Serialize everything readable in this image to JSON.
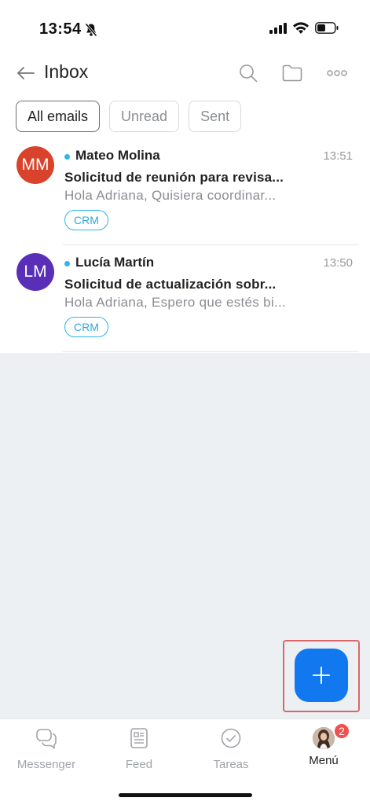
{
  "status_bar": {
    "time": "13:54"
  },
  "header": {
    "title": "Inbox"
  },
  "filters": [
    {
      "label": "All emails",
      "active": true
    },
    {
      "label": "Unread",
      "active": false
    },
    {
      "label": "Sent",
      "active": false
    }
  ],
  "emails": [
    {
      "initials": "MM",
      "avatar_color": "#d9432b",
      "sender": "Mateo Molina",
      "time": "13:51",
      "subject": "Solicitud de reunión para revisa...",
      "preview": "Hola Adriana, Quisiera coordinar...",
      "tag": "CRM"
    },
    {
      "initials": "LM",
      "avatar_color": "#5a2fb8",
      "sender": "Lucía Martín",
      "time": "13:50",
      "subject": "Solicitud de actualización sobr...",
      "preview": "Hola Adriana, Espero que estés bi...",
      "tag": "CRM"
    }
  ],
  "tabbar": {
    "items": [
      {
        "label": "Messenger",
        "icon": "messenger-icon"
      },
      {
        "label": "Feed",
        "icon": "feed-icon"
      },
      {
        "label": "Tareas",
        "icon": "tasks-icon"
      },
      {
        "label": "Menú",
        "icon": "avatar"
      }
    ],
    "badge": "2"
  },
  "colors": {
    "accent": "#1178f0",
    "unread_dot": "#2fb4ec",
    "badge": "#f0504f"
  }
}
